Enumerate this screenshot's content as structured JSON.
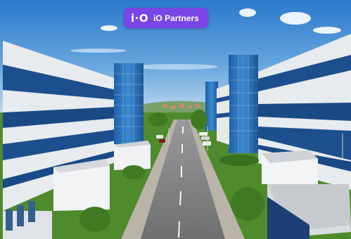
{
  "overlay": {
    "logo_mark": "i·O",
    "brand_label": "iO Partners",
    "accent_color": "#7a45e6"
  },
  "scene": {
    "sky_color": "#2f7fd0",
    "glass_color": "#2a6fb5",
    "facade_color": "#e9ecef",
    "grass_color": "#4d8f2a",
    "road_color": "#8a8a8c"
  }
}
